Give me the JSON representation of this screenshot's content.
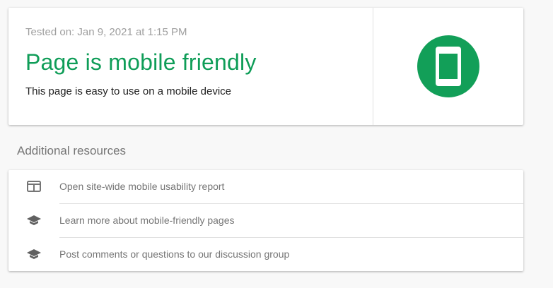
{
  "result": {
    "tested_on": "Tested on: Jan 9, 2021 at 1:15 PM",
    "title": "Page is mobile friendly",
    "description": "This page is easy to use on a mobile device",
    "icon": "mobile-phone-icon",
    "accent": "#0f9d58"
  },
  "resources": {
    "heading": "Additional resources",
    "items": [
      {
        "label": "Open site-wide mobile usability report",
        "icon": "report-icon"
      },
      {
        "label": "Learn more about mobile-friendly pages",
        "icon": "graduation-cap-icon"
      },
      {
        "label": "Post comments or questions to our discussion group",
        "icon": "graduation-cap-icon"
      }
    ]
  }
}
